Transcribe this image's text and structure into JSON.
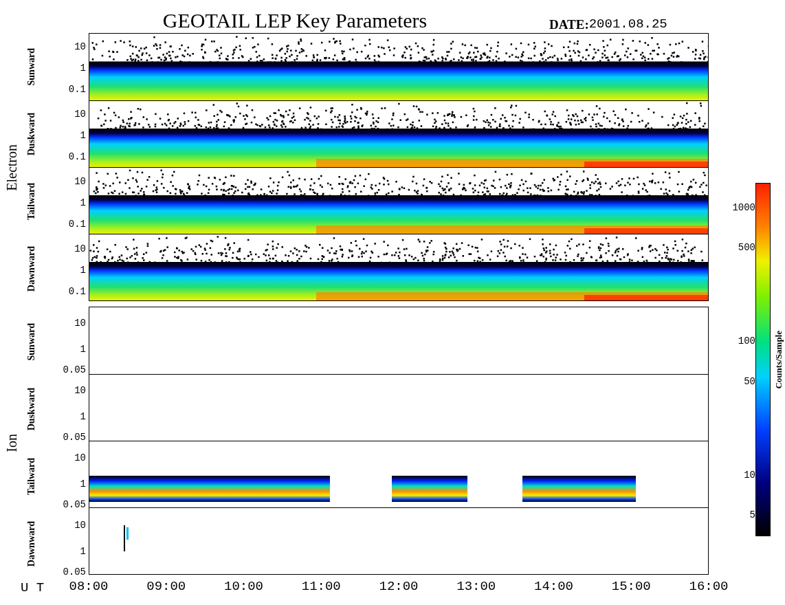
{
  "title": "GEOTAIL LEP Key Parameters",
  "date": {
    "label": "DATE:",
    "value": "2001.08.25"
  },
  "groups": [
    {
      "name": "Electron",
      "kind": "electron",
      "panels": [
        {
          "direction": "Sunward",
          "kind": "full",
          "yticks": [
            "10",
            "1",
            "0.1"
          ]
        },
        {
          "direction": "Duskward",
          "kind": "full",
          "yticks": [
            "10",
            "1",
            "0.1"
          ]
        },
        {
          "direction": "Tailward",
          "kind": "full",
          "yticks": [
            "10",
            "1",
            "0.1"
          ]
        },
        {
          "direction": "Dawnward",
          "kind": "full",
          "yticks": [
            "10",
            "1",
            "0.1"
          ]
        }
      ]
    },
    {
      "name": "Ion",
      "kind": "ion",
      "panels": [
        {
          "direction": "Sunward",
          "kind": "empty",
          "yticks": [
            "10",
            "1",
            "0.05"
          ]
        },
        {
          "direction": "Duskward",
          "kind": "empty",
          "yticks": [
            "10",
            "1",
            "0.05"
          ]
        },
        {
          "direction": "Tailward",
          "kind": "bursts",
          "yticks": [
            "10",
            "1",
            "0.05"
          ]
        },
        {
          "direction": "Dawnward",
          "kind": "spike",
          "yticks": [
            "10",
            "1",
            "0.05"
          ]
        }
      ]
    }
  ],
  "x_axis": {
    "label": "U T",
    "ticks": [
      "08:00",
      "09:00",
      "10:00",
      "11:00",
      "12:00",
      "13:00",
      "14:00",
      "15:00",
      "16:00"
    ]
  },
  "colorbar": {
    "label": "Counts/Sample",
    "ticks": [
      "1000",
      "500",
      "100",
      "50",
      "10",
      "5"
    ]
  }
}
